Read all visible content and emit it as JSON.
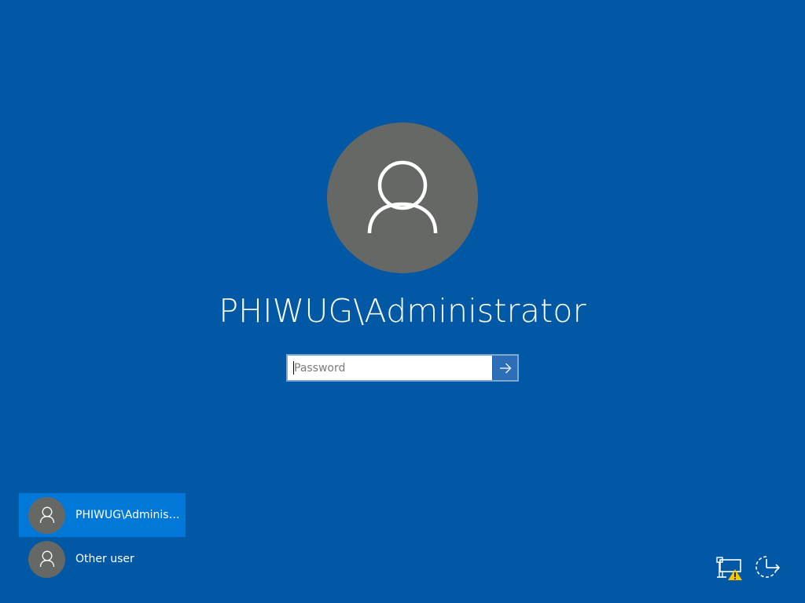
{
  "login": {
    "username": "PHIWUG\\Administrator",
    "password_placeholder": "Password",
    "password_value": "",
    "submit_icon": "arrow-right-icon",
    "avatar_icon": "user-icon"
  },
  "user_list": [
    {
      "name": "PHIWUG\\Administrator",
      "selected": true,
      "icon": "user-icon"
    },
    {
      "name": "Other user",
      "selected": false,
      "icon": "user-icon"
    }
  ],
  "tray": {
    "network_icon": "network-warning-icon",
    "power_icon": "power-ease-of-access-icon"
  },
  "colors": {
    "background": "#0158a4",
    "avatar": "#666866",
    "selected_user": "#0078d7",
    "submit_button": "#2d6eb8",
    "warning": "#f7c600"
  }
}
